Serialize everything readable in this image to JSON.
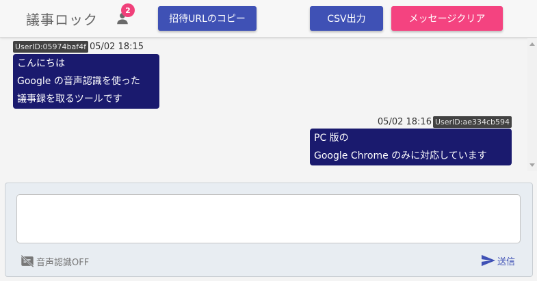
{
  "header": {
    "title": "議事ロック",
    "user_count": "2",
    "buttons": {
      "invite": "招待URLのコピー",
      "csv": "CSV出力",
      "clear": "メッセージクリア"
    }
  },
  "messages": [
    {
      "user_id": "UserID:05974baf4f",
      "time": "05/02 18:15",
      "lines": [
        "こんにちは",
        "Google の音声認識を使った",
        "議事録を取るツールです"
      ]
    },
    {
      "user_id": "UserID:ae334cb594",
      "time": "05/02 18:16",
      "lines": [
        "PC 版の",
        "Google Chrome のみに対応しています"
      ]
    }
  ],
  "composer": {
    "input_value": "",
    "voice_label": "音声認識OFF",
    "send_label": "送信"
  },
  "colors": {
    "primary": "#3f51b5",
    "accent": "#f44380",
    "bubble": "#1a1a6e",
    "uid_tag": "#424242"
  },
  "icons": {
    "user": "person-icon",
    "mic_off": "closed-caption-off-icon",
    "send": "send-icon"
  }
}
